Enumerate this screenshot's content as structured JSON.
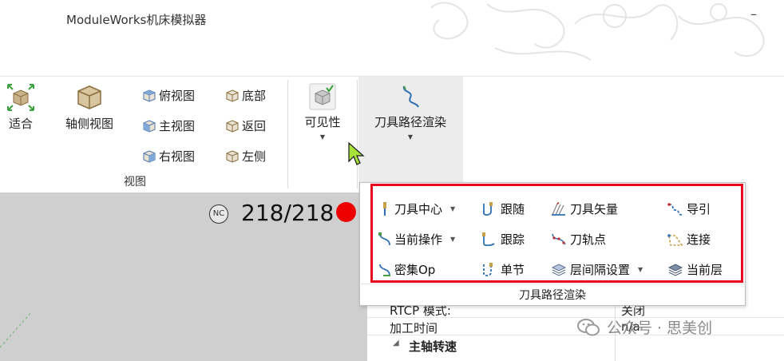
{
  "window": {
    "title": "ModuleWorks机床模拟器",
    "minimize": "–"
  },
  "ribbon": {
    "view_group": {
      "fit": "适合",
      "axonometric": "轴侧视图",
      "top": "俯视图",
      "bottom": "底部",
      "front": "主视图",
      "back": "返回",
      "right": "右视图",
      "left": "左侧",
      "label": "视图"
    },
    "visibility": "可见性",
    "toolpath_render": "刀具路径渲染"
  },
  "viewport": {
    "nc_badge": "NC",
    "counter": "218/218"
  },
  "popup": {
    "items": [
      {
        "label": "刀具中心",
        "icon": "tool-center-icon",
        "dropdown": true
      },
      {
        "label": "跟随",
        "icon": "follow-icon"
      },
      {
        "label": "刀具矢量",
        "icon": "tool-vector-icon"
      },
      {
        "label": "导引",
        "icon": "lead-icon"
      },
      {
        "label": "当前操作",
        "icon": "current-op-icon",
        "dropdown": true
      },
      {
        "label": "跟踪",
        "icon": "trace-icon"
      },
      {
        "label": "刀轨点",
        "icon": "toolpath-point-icon"
      },
      {
        "label": "连接",
        "icon": "link-icon"
      },
      {
        "label": "密集Op",
        "icon": "dense-op-icon"
      },
      {
        "label": "单节",
        "icon": "single-block-icon"
      },
      {
        "label": "层间隔设置",
        "icon": "layer-spacing-icon",
        "dropdown": true
      },
      {
        "label": "当前层",
        "icon": "current-layer-icon"
      }
    ],
    "footer": "刀具路径渲染"
  },
  "properties": {
    "rows": [
      {
        "name": "RTCP 模式:",
        "value": "关闭"
      },
      {
        "name": "加工时间",
        "value": "n/a"
      }
    ],
    "section": "主轴转速"
  },
  "watermark": {
    "text": "公众号 · 思美创"
  },
  "colors": {
    "highlight_box": "#e8001c",
    "status_dot": "#ee0000",
    "viewport_bg": "#cfcfcf"
  }
}
